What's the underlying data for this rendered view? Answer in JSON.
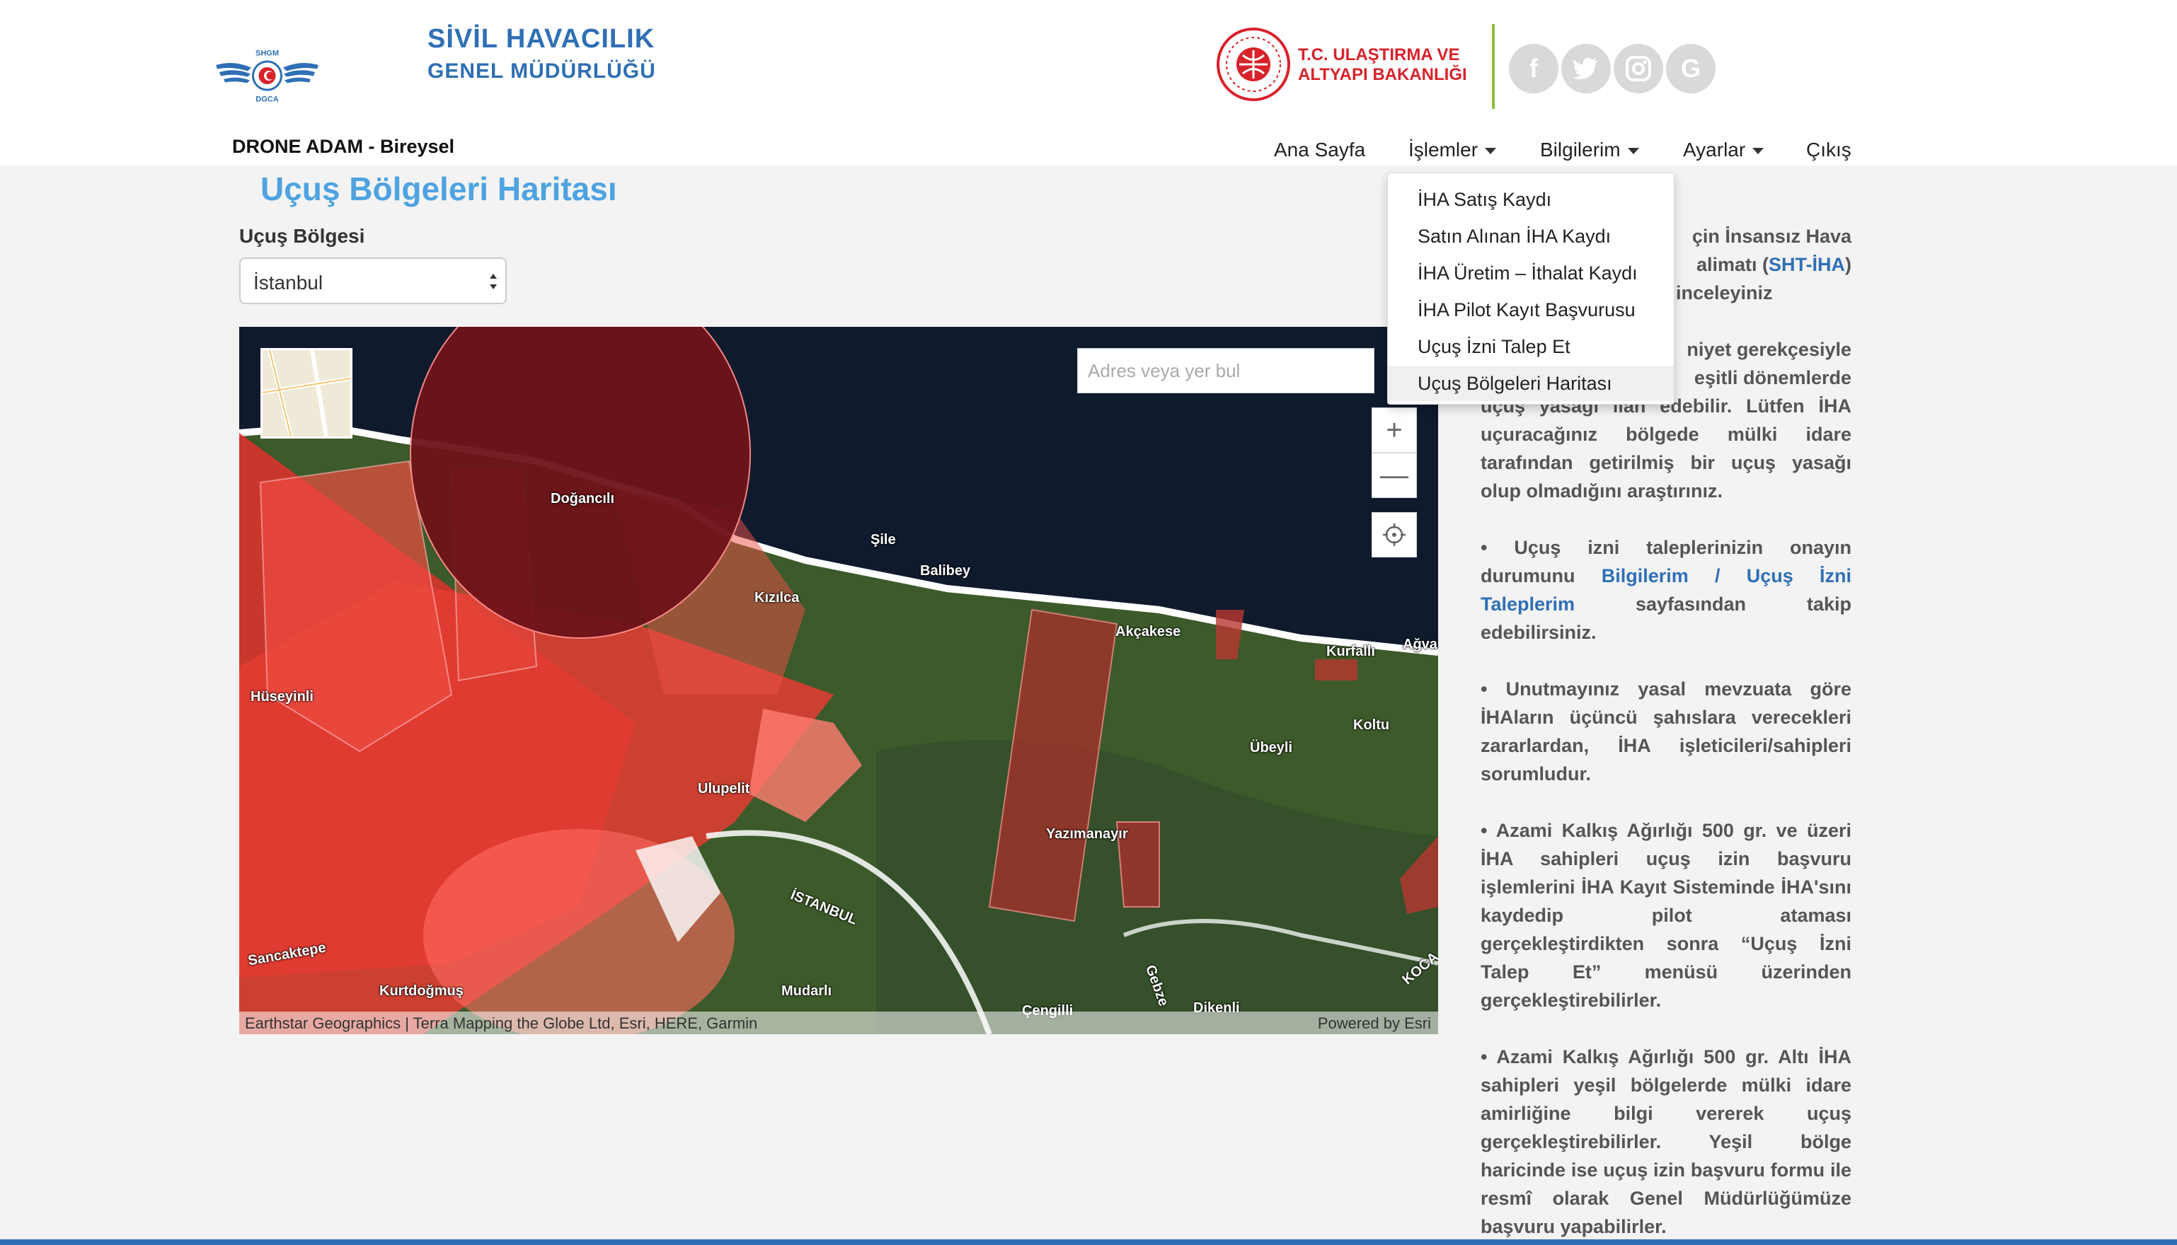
{
  "brand": {
    "line1": "SİVİL HAVACILIK",
    "line2": "GENEL MÜDÜRLÜĞÜ",
    "logo_top": "SHGM",
    "logo_bottom": "DGCA",
    "color": "#2f6fb5"
  },
  "user_label": "DRONE ADAM - Bireysel",
  "ministry": {
    "line1": "T.C. ULAŞTIRMA VE",
    "line2": "ALTYAPI BAKANLIĞI",
    "color": "#d8222a"
  },
  "social": [
    {
      "icon": "facebook-icon",
      "glyph": "f"
    },
    {
      "icon": "twitter-icon",
      "glyph": "🐦"
    },
    {
      "icon": "instagram-icon",
      "glyph": "◎"
    },
    {
      "icon": "google-icon",
      "glyph": "G"
    }
  ],
  "nav": {
    "home": "Ana Sayfa",
    "operations": "İşlemler",
    "info": "Bilgilerim",
    "settings": "Ayarlar",
    "logout": "Çıkış"
  },
  "dropdown": {
    "items": [
      "İHA Satış Kaydı",
      "Satın Alınan İHA Kaydı",
      "İHA Üretim – İthalat Kaydı",
      "İHA Pilot Kayıt Başvurusu",
      "Uçuş İzni Talep Et",
      "Uçuş Bölgeleri Haritası"
    ],
    "active_index": 5
  },
  "page_title": "Uçuş Bölgeleri Haritası",
  "region": {
    "label": "Uçuş Bölgesi",
    "selected": "İstanbul"
  },
  "map": {
    "search_placeholder": "Adres veya yer bul",
    "zoom_in": "+",
    "zoom_out": "—",
    "attribution_left": "Earthstar Geographics | Terra Mapping the Globe Ltd, Esri, HERE, Garmin",
    "attribution_right": "Powered by Esri",
    "places": {
      "dogancili": "Doğancılı",
      "sile": "Şile",
      "balibey": "Balibey",
      "kizilca": "Kızılca",
      "akcakese": "Akçakese",
      "kurfalli": "Kurfallı",
      "agva": "Ağva",
      "huseyinli": "Hüseyinli",
      "koltu": "Koltu",
      "ubeyli": "Übeyli",
      "ulupelit": "Ulupelit",
      "yazimanayir": "Yazımanayır",
      "istanbul": "İSTANBUL",
      "sancaktepe": "Sancaktepe",
      "kurtdogmus": "Kurtdoğmuş",
      "mudarli": "Mudarlı",
      "cengilli": "Çengilli",
      "dikenli": "Dikenli",
      "gebze": "Gebze",
      "koca": "KOCA"
    }
  },
  "side": {
    "p1_a": "çin İnsansız Hava",
    "p1_b": "alimatı (",
    "p1_link": "SHT-İHA",
    "p1_c": ")",
    "p1_d": "inceleyiniz",
    "p2_a": "niyet gerekçesiyle",
    "p2_b": "eşitli dönemlerde",
    "p2_c": "uçuş yasağı ilan edebilir. Lütfen İHA uçuracağınız bölgede mülki idare tarafından getirilmiş bir uçuş yasağı olup olmadığını araştırınız.",
    "p3_a": "• Uçuş izni taleplerinizin onayın durumunu",
    "p3_link": "Bilgilerim / Uçuş İzni Taleplerim",
    "p3_b": "sayfasından takip edebilirsiniz.",
    "p4": "• Unutmayınız yasal mevzuata göre İHAların üçüncü şahıslara verecekleri zararlardan, İHA işleticileri/sahipleri sorumludur.",
    "p5": "• Azami Kalkış Ağırlığı 500 gr. ve üzeri İHA sahipleri uçuş izin başvuru işlemlerini İHA Kayıt Sisteminde İHA'sını kaydedip pilot ataması gerçekleştirdikten sonra “Uçuş İzni Talep Et” menüsü üzerinden gerçekleştirebilirler.",
    "p6": "• Azami Kalkış Ağırlığı 500 gr. Altı İHA sahipleri yeşil bölgelerde mülki idare amirliğine bilgi vererek uçuş gerçekleştirebilirler. Yeşil bölge haricinde ise uçuş izin başvuru formu ile resmî olarak Genel Müdürlüğümüze başvuru yapabilirler."
  }
}
